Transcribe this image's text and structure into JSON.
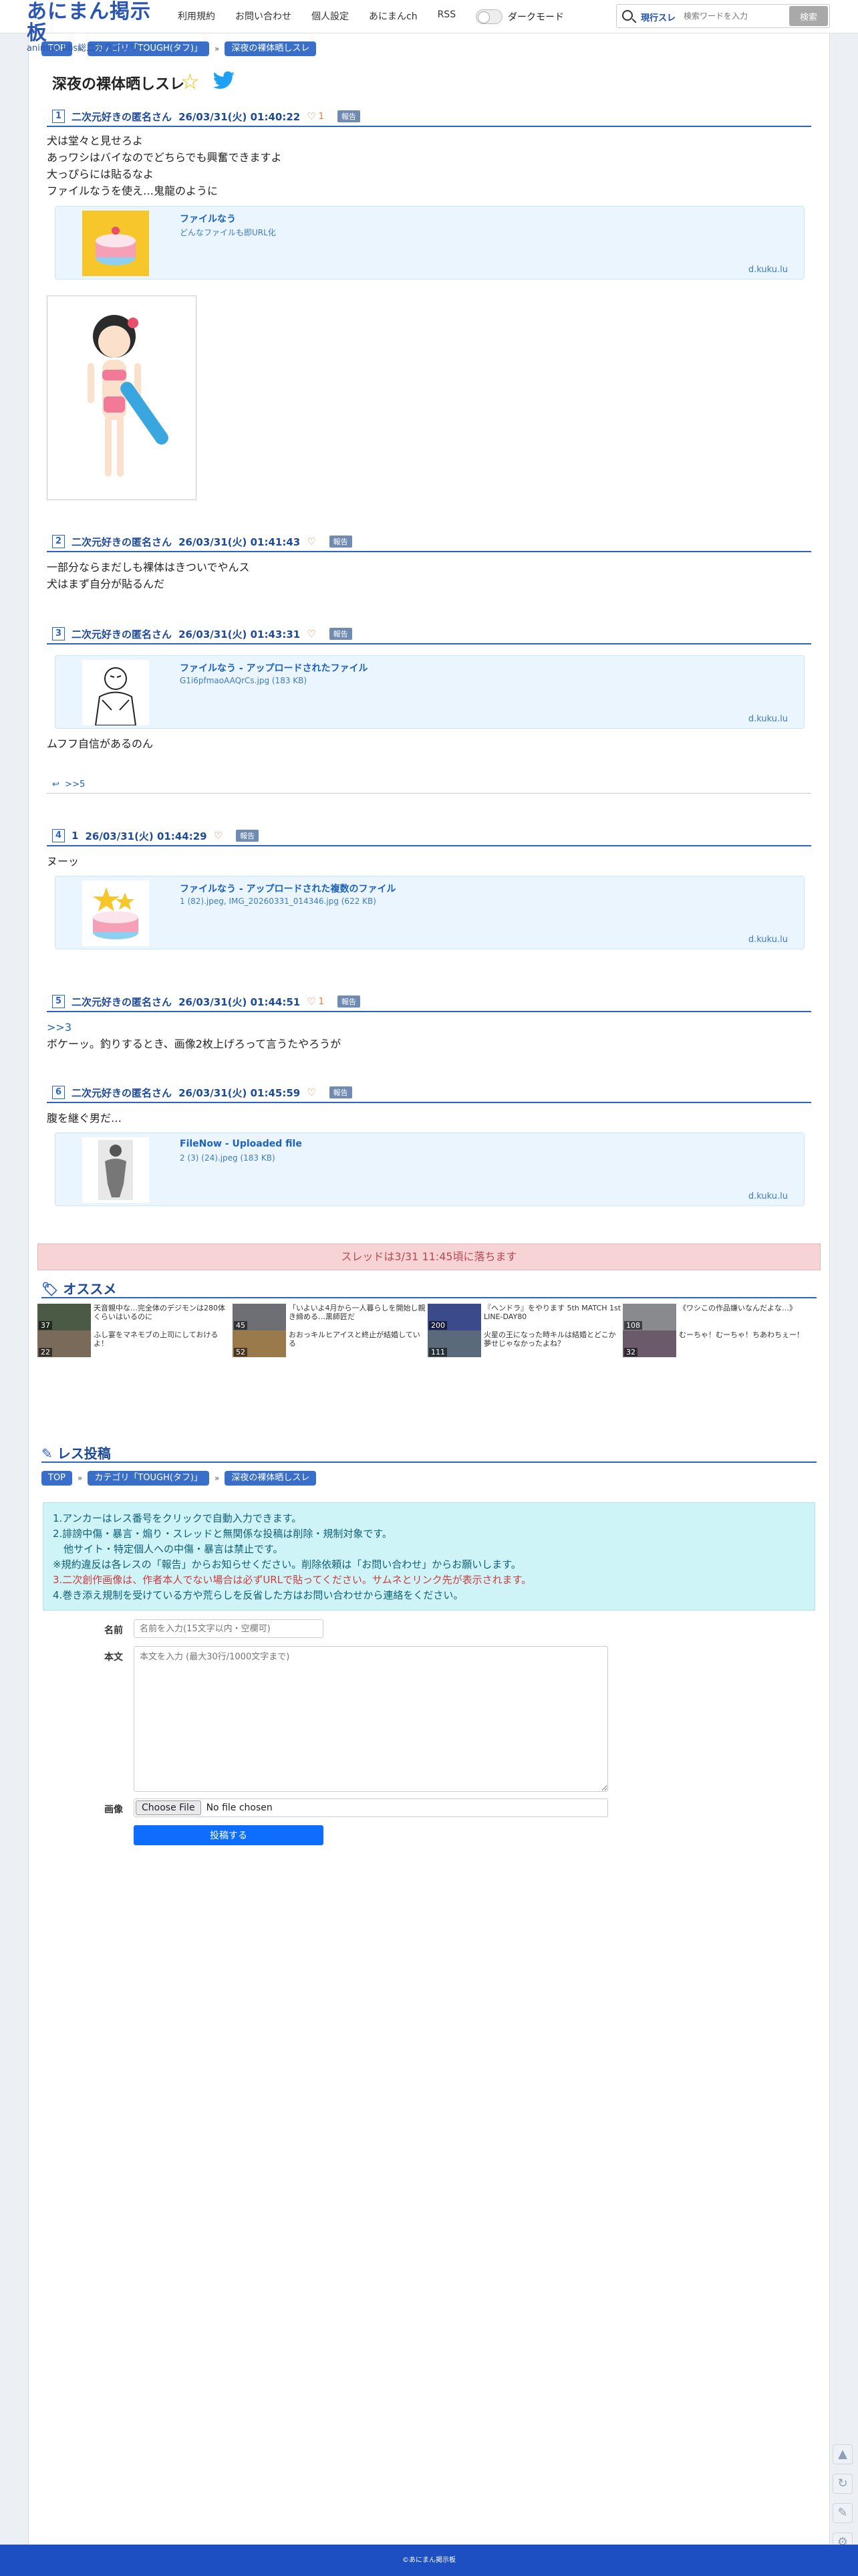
{
  "header": {
    "logo_title": "あにまん掲示板",
    "logo_sub": "animan bbs総二次元オンリー",
    "nav": [
      "利用規約",
      "お問い合わせ",
      "個人設定",
      "あにまんch",
      "RSS"
    ],
    "dark_mode_label": "ダークモード",
    "search_scope": "現行スレ",
    "search_placeholder": "検索ワードを入力",
    "search_button": "検索"
  },
  "breadcrumb": [
    "TOP",
    "カテゴリ「TOUGH(タフ)」",
    "深夜の裸体晒しスレ"
  ],
  "thread_title": "深夜の裸体晒しスレ",
  "posts": [
    {
      "no": "1",
      "name": "二次元好きの匿名さん",
      "date": "26/03/31(火) 01:40:22",
      "likes": "1",
      "report": "報告",
      "body": [
        "犬は堂々と見せろよ",
        "あっワシはバイなのでどちらでも興奮できますよ ",
        "大っぴらには貼るなよ",
        "ファイルなうを使え…鬼龍のように"
      ],
      "file": {
        "title": "ファイルなう",
        "desc": "どんなファイルも即URL化",
        "domain": "d.kuku.lu"
      }
    },
    {
      "no": "2",
      "name": "二次元好きの匿名さん",
      "date": "26/03/31(火) 01:41:43",
      "likes": "",
      "report": "報告",
      "body": [
        "一部分ならまだしも裸体はきついでやんス",
        "犬はまず自分が貼るんだ"
      ]
    },
    {
      "no": "3",
      "name": "二次元好きの匿名さん",
      "date": "26/03/31(火) 01:43:31",
      "likes": "",
      "report": "報告",
      "body": [
        "ムフフ自信があるのん"
      ],
      "file": {
        "title": "ファイルなう - アップロードされたファイル",
        "desc": "G1i6pfmaoAAQrCs.jpg (183 KB)",
        "domain": "d.kuku.lu"
      },
      "reply": ">>5"
    },
    {
      "no": "4",
      "name": "1",
      "date": "26/03/31(火) 01:44:29",
      "likes": "",
      "report": "報告",
      "body": [
        "ヌーッ"
      ],
      "file": {
        "title": "ファイルなう - アップロードされた複数のファイル",
        "desc": "1 (82).jpeg, IMG_20260331_014346.jpg (622 KB)",
        "domain": "d.kuku.lu"
      }
    },
    {
      "no": "5",
      "name": "二次元好きの匿名さん",
      "date": "26/03/31(火) 01:44:51",
      "likes": "1",
      "report": "報告",
      "anchor": ">>3",
      "body": [
        "ボケーッ。釣りするとき、画像2枚上げろって言うたやろうが"
      ]
    },
    {
      "no": "6",
      "name": "二次元好きの匿名さん",
      "date": "26/03/31(火) 01:45:59",
      "likes": "",
      "report": "報告",
      "body": [
        "腹を継ぐ男だ…"
      ],
      "file": {
        "title": "FileNow - Uploaded file",
        "desc": "2 (3) (24).jpeg (183 KB)",
        "domain": "d.kuku.lu"
      }
    }
  ],
  "fall_notice": "スレッドは3/31 11:45頃に落ちます",
  "recommend": {
    "title": "オススメ",
    "items": [
      {
        "text": "天音親中な…完全体のデジモンは280体くらいはいるのに",
        "count": "37"
      },
      {
        "text": "「いよいよ4月から一人暮らしを開始し親き締める…黒師匠だ",
        "count": "45"
      },
      {
        "text": "『ヘンドラ』をやります 5th MATCH 1st LINE-DAY80",
        "count": "200"
      },
      {
        "text": "《ワシこの作品嫌いなんだよな…》",
        "count": "108"
      },
      {
        "text": "ふし宴をマネモブの上司にしておけるよ！",
        "count": "22"
      },
      {
        "text": "おおっキルヒアイスと終止が結婚している",
        "count": "52"
      },
      {
        "text": "火星の王になった時キルは結婚とどこか夢せじゃなかったよね？",
        "count": "111"
      },
      {
        "text": "むーちゃ！むーちゃ！ちあわちぇー！",
        "count": "32"
      }
    ]
  },
  "post_form": {
    "title": "レス投稿",
    "rules": [
      "1.アンカーはレス番号をクリックで自動入力できます。",
      "2.誹謗中傷・暴言・煽り・スレッドと無関係な投稿は削除・規制対象です。",
      "他サイト・特定個人への中傷・暴言は禁止です。",
      "※規約違反は各レスの「報告」からお知らせください。削除依頼は「お問い合わせ」からお願いします。",
      "3.二次創作画像は、作者本人でない場合は必ずURLで貼ってください。サムネとリンク先が表示されます。",
      "4.巻き添え規制を受けている方や荒らしを反省した方はお問い合わせから連絡をください。"
    ],
    "name_label": "名前",
    "name_placeholder": "名前を入力(15文字以内・空欄可)",
    "body_label": "本文",
    "body_placeholder": "本文を入力 (最大30行/1000文字まで)",
    "image_label": "画像",
    "choose_file": "Choose File",
    "no_file": "No file chosen",
    "submit": "投稿する"
  },
  "footer": "©あにまん掲示板"
}
